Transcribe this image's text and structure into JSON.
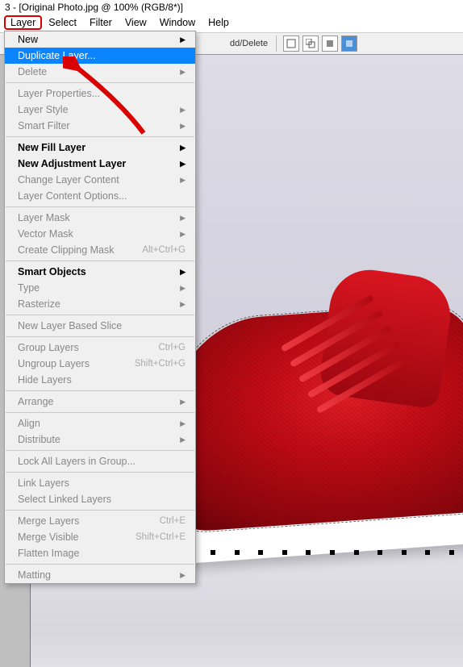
{
  "titlebar": "3 - [Original Photo.jpg @ 100% (RGB/8*)]",
  "menubar": [
    "Layer",
    "Select",
    "Filter",
    "View",
    "Window",
    "Help"
  ],
  "toolbar": {
    "label_fragment": "dd/Delete"
  },
  "dropdown": {
    "groups": [
      [
        {
          "label": "New",
          "sub": true,
          "bold": false
        },
        {
          "label": "Duplicate Layer...",
          "highlight": true,
          "bold": false
        },
        {
          "label": "Delete",
          "sub": true,
          "disabled": true
        }
      ],
      [
        {
          "label": "Layer Properties...",
          "disabled": true
        },
        {
          "label": "Layer Style",
          "sub": true,
          "disabled": true
        },
        {
          "label": "Smart Filter",
          "sub": true,
          "disabled": true
        }
      ],
      [
        {
          "label": "New Fill Layer",
          "sub": true,
          "bold": true
        },
        {
          "label": "New Adjustment Layer",
          "sub": true,
          "bold": true
        },
        {
          "label": "Change Layer Content",
          "sub": true,
          "disabled": true
        },
        {
          "label": "Layer Content Options...",
          "disabled": true
        }
      ],
      [
        {
          "label": "Layer Mask",
          "sub": true,
          "disabled": true
        },
        {
          "label": "Vector Mask",
          "sub": true,
          "disabled": true
        },
        {
          "label": "Create Clipping Mask",
          "shortcut": "Alt+Ctrl+G",
          "disabled": true
        }
      ],
      [
        {
          "label": "Smart Objects",
          "sub": true,
          "bold": true
        },
        {
          "label": "Type",
          "sub": true,
          "disabled": true
        },
        {
          "label": "Rasterize",
          "sub": true,
          "disabled": true
        }
      ],
      [
        {
          "label": "New Layer Based Slice",
          "disabled": true
        }
      ],
      [
        {
          "label": "Group Layers",
          "shortcut": "Ctrl+G",
          "disabled": true
        },
        {
          "label": "Ungroup Layers",
          "shortcut": "Shift+Ctrl+G",
          "disabled": true
        },
        {
          "label": "Hide Layers",
          "disabled": true
        }
      ],
      [
        {
          "label": "Arrange",
          "sub": true,
          "disabled": true
        }
      ],
      [
        {
          "label": "Align",
          "sub": true,
          "disabled": true
        },
        {
          "label": "Distribute",
          "sub": true,
          "disabled": true
        }
      ],
      [
        {
          "label": "Lock All Layers in Group...",
          "disabled": true
        }
      ],
      [
        {
          "label": "Link Layers",
          "disabled": true
        },
        {
          "label": "Select Linked Layers",
          "disabled": true
        }
      ],
      [
        {
          "label": "Merge Layers",
          "shortcut": "Ctrl+E",
          "disabled": true
        },
        {
          "label": "Merge Visible",
          "shortcut": "Shift+Ctrl+E",
          "disabled": true
        },
        {
          "label": "Flatten Image",
          "disabled": true
        }
      ],
      [
        {
          "label": "Matting",
          "sub": true,
          "disabled": true
        }
      ]
    ]
  },
  "annotation": {
    "arrow_color": "#d80000"
  }
}
